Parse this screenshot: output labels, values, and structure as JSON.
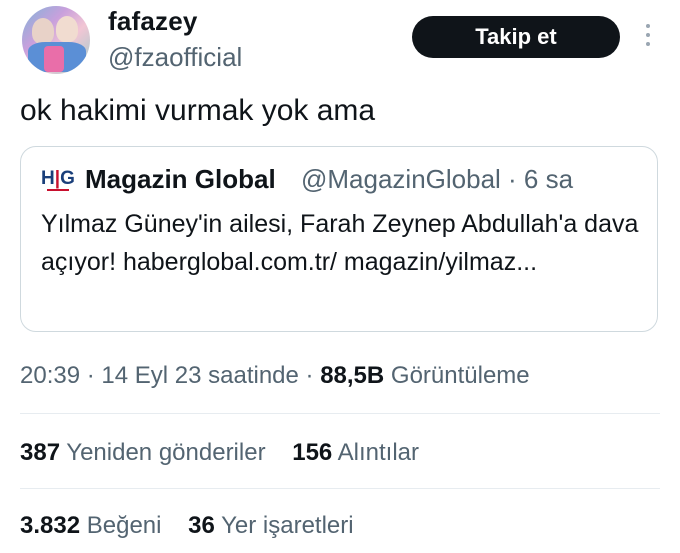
{
  "author": {
    "name": "fafazey",
    "handle": "@fzaofficial",
    "follow_label": "Takip et"
  },
  "tweet": {
    "text": "ok hakimi vurmak yok ama"
  },
  "quote": {
    "logo_text_h": "H",
    "logo_text_sep": "|",
    "logo_text_g": "G",
    "name": "Magazin Global",
    "handle_time": "@MagazinGlobal · 6 sa",
    "text": "Yılmaz Güney'in ailesi, Farah Zeynep Abdullah'a dava açıyor! haberglobal.com.tr/ magazin/yilmaz..."
  },
  "meta": {
    "time_date": "20:39 · 14 Eyl 23 saatinde · ",
    "views_count": "88,5B",
    "views_label": " Görüntüleme"
  },
  "stats": {
    "retweets_count": "387",
    "retweets_label": "Yeniden gönderiler",
    "quotes_count": "156",
    "quotes_label": "Alıntılar",
    "likes_count": "3.832",
    "likes_label": "Beğeni",
    "bookmarks_count": "36",
    "bookmarks_label": "Yer işaretleri"
  }
}
